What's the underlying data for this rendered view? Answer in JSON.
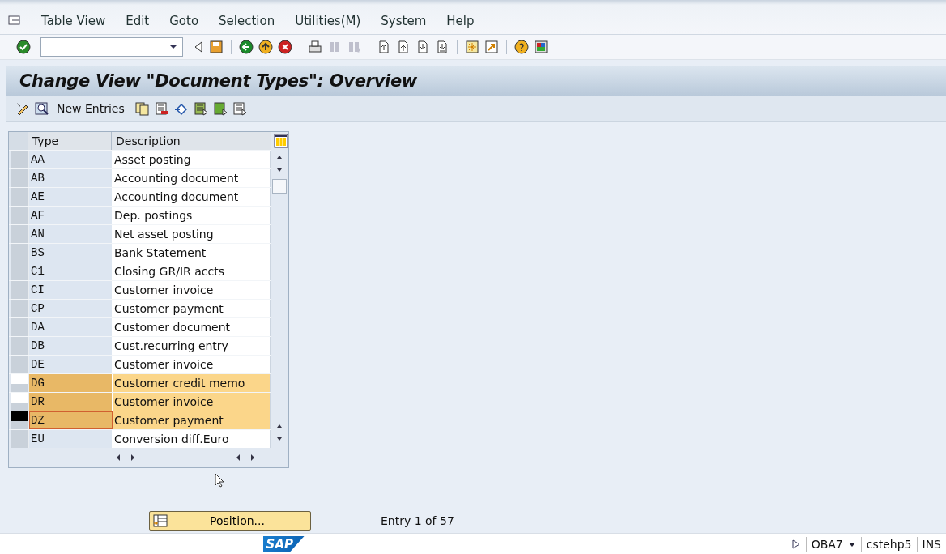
{
  "menu": [
    "Table View",
    "Edit",
    "Goto",
    "Selection",
    "Utilities(M)",
    "System",
    "Help"
  ],
  "screen_title": "Change View \"Document Types\": Overview",
  "app_toolbar": {
    "new_entries": "New Entries"
  },
  "table": {
    "columns": [
      "Type",
      "Description"
    ],
    "rows": [
      {
        "type": "AA",
        "description": "Asset posting",
        "selected": false,
        "current": false
      },
      {
        "type": "AB",
        "description": "Accounting document",
        "selected": false,
        "current": false
      },
      {
        "type": "AE",
        "description": "Accounting document",
        "selected": false,
        "current": false
      },
      {
        "type": "AF",
        "description": "Dep. postings",
        "selected": false,
        "current": false
      },
      {
        "type": "AN",
        "description": "Net asset posting",
        "selected": false,
        "current": false
      },
      {
        "type": "BS",
        "description": "Bank Statement",
        "selected": false,
        "current": false
      },
      {
        "type": "C1",
        "description": "Closing GR/IR accts",
        "selected": false,
        "current": false
      },
      {
        "type": "CI",
        "description": "Customer invoice",
        "selected": false,
        "current": false
      },
      {
        "type": "CP",
        "description": "Customer payment",
        "selected": false,
        "current": false
      },
      {
        "type": "DA",
        "description": "Customer document",
        "selected": false,
        "current": false
      },
      {
        "type": "DB",
        "description": "Cust.recurring entry",
        "selected": false,
        "current": false
      },
      {
        "type": "DE",
        "description": "Customer invoice",
        "selected": false,
        "current": false
      },
      {
        "type": "DG",
        "description": "Customer credit memo",
        "selected": true,
        "current": false
      },
      {
        "type": "DR",
        "description": "Customer invoice",
        "selected": true,
        "current": false
      },
      {
        "type": "DZ",
        "description": "Customer payment",
        "selected": true,
        "current": true
      },
      {
        "type": "EU",
        "description": "Conversion diff.Euro",
        "selected": false,
        "current": false
      }
    ]
  },
  "position_button": "Position...",
  "entry_info": "Entry 1 of 57",
  "status_bar": {
    "logo": "SAP",
    "transaction": "OBA7",
    "server": "cstehp5",
    "mode": "INS"
  }
}
